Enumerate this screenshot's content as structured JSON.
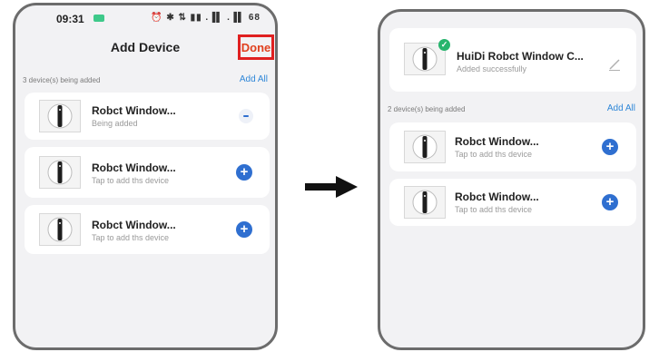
{
  "left_screen": {
    "status_bar": {
      "time": "09:31",
      "icons_text": "⏰ ✱ ⇅ ▮▮ .▐▌ .▐▌ 68"
    },
    "title": "Add Device",
    "done_label": "Done",
    "section": {
      "label": "3 device(s) being added",
      "add_all": "Add All"
    },
    "devices": [
      {
        "name": "Robct Window...",
        "status": "Being added",
        "action": "loading"
      },
      {
        "name": "Robct Window...",
        "status": "Tap to add ths device",
        "action": "add"
      },
      {
        "name": "Robct Window...",
        "status": "Tap to add ths device",
        "action": "add"
      }
    ]
  },
  "right_screen": {
    "added_device": {
      "name": "HuiDi Robct Window C...",
      "status": "Added successfully"
    },
    "section": {
      "label": "2 device(s) being added",
      "add_all": "Add All"
    },
    "devices": [
      {
        "name": "Robct Window...",
        "status": "Tap to add ths device",
        "action": "add"
      },
      {
        "name": "Robct Window...",
        "status": "Tap to add ths device",
        "action": "add"
      }
    ]
  },
  "icons": {
    "plus": "+",
    "check": "✓",
    "arrow": "arrow-right-icon"
  },
  "colors": {
    "accent_blue": "#2f6fd0",
    "done_red": "#e02020",
    "success_green": "#27b56d"
  }
}
